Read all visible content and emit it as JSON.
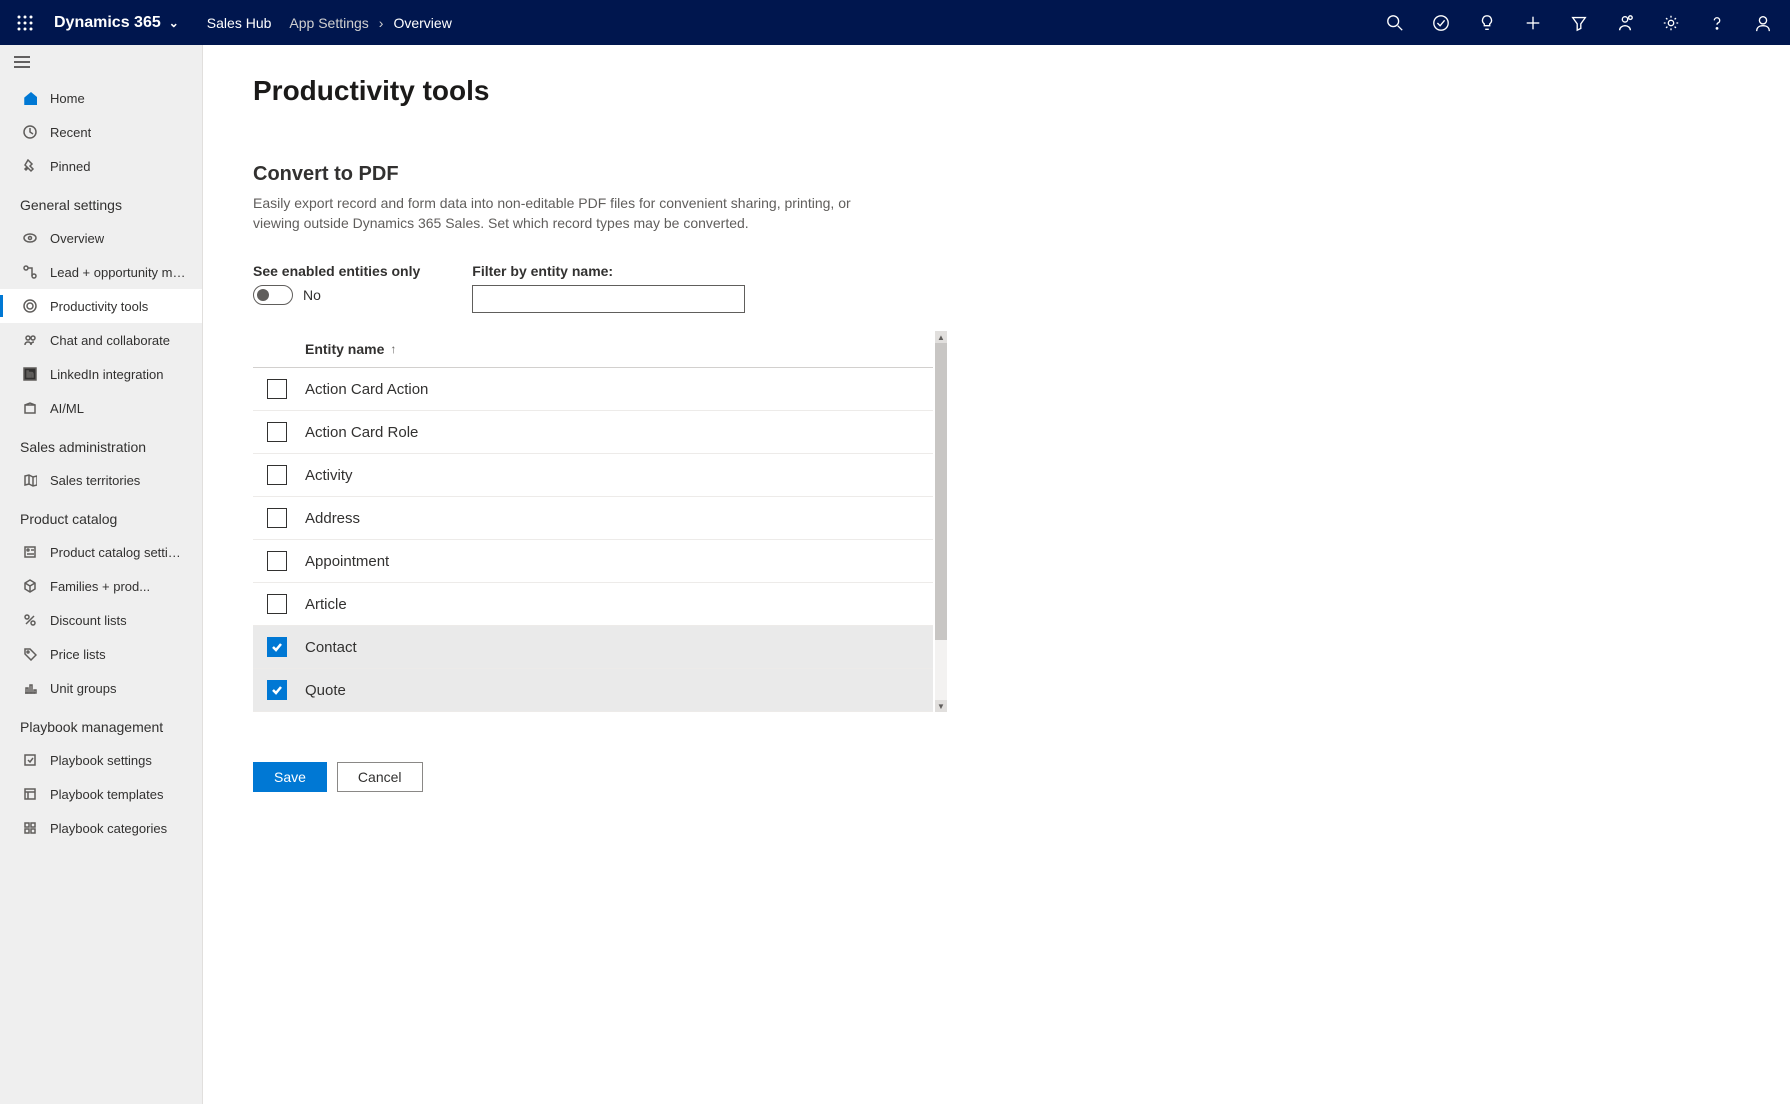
{
  "brand": "Dynamics 365",
  "app_name": "Sales Hub",
  "breadcrumb": [
    "App Settings",
    "Overview"
  ],
  "sidebar": {
    "top": [
      {
        "label": "Home",
        "icon": "home"
      },
      {
        "label": "Recent",
        "icon": "clock"
      },
      {
        "label": "Pinned",
        "icon": "pin"
      }
    ],
    "sections": [
      {
        "title": "General settings",
        "items": [
          {
            "label": "Overview",
            "icon": "eye"
          },
          {
            "label": "Lead + opportunity ma...",
            "icon": "flow"
          },
          {
            "label": "Productivity tools",
            "icon": "target",
            "active": true
          },
          {
            "label": "Chat and collaborate",
            "icon": "people"
          },
          {
            "label": "LinkedIn integration",
            "icon": "linkedin"
          },
          {
            "label": "AI/ML",
            "icon": "box"
          }
        ]
      },
      {
        "title": "Sales administration",
        "items": [
          {
            "label": "Sales territories",
            "icon": "map"
          }
        ]
      },
      {
        "title": "Product catalog",
        "items": [
          {
            "label": "Product catalog settings",
            "icon": "catalog"
          },
          {
            "label": "Families + prod...",
            "icon": "cube"
          },
          {
            "label": "Discount lists",
            "icon": "percent"
          },
          {
            "label": "Price lists",
            "icon": "pricetag"
          },
          {
            "label": "Unit groups",
            "icon": "chart"
          }
        ]
      },
      {
        "title": "Playbook management",
        "items": [
          {
            "label": "Playbook settings",
            "icon": "check-square"
          },
          {
            "label": "Playbook templates",
            "icon": "template"
          },
          {
            "label": "Playbook categories",
            "icon": "category"
          }
        ]
      }
    ]
  },
  "main": {
    "page_title": "Productivity tools",
    "section_title": "Convert to PDF",
    "section_desc": "Easily export record and form data into non-editable PDF files for convenient sharing, printing, or viewing outside Dynamics 365 Sales. Set which record types may be converted.",
    "toggle_label": "See enabled entities only",
    "toggle_value": "No",
    "filter_label": "Filter by entity name:",
    "column_header": "Entity name",
    "entities": [
      {
        "name": "Action Card Action",
        "checked": false
      },
      {
        "name": "Action Card Role",
        "checked": false
      },
      {
        "name": "Activity",
        "checked": false
      },
      {
        "name": "Address",
        "checked": false
      },
      {
        "name": "Appointment",
        "checked": false
      },
      {
        "name": "Article",
        "checked": false
      },
      {
        "name": "Contact",
        "checked": true
      },
      {
        "name": "Quote",
        "checked": true
      }
    ],
    "save_label": "Save",
    "cancel_label": "Cancel"
  }
}
